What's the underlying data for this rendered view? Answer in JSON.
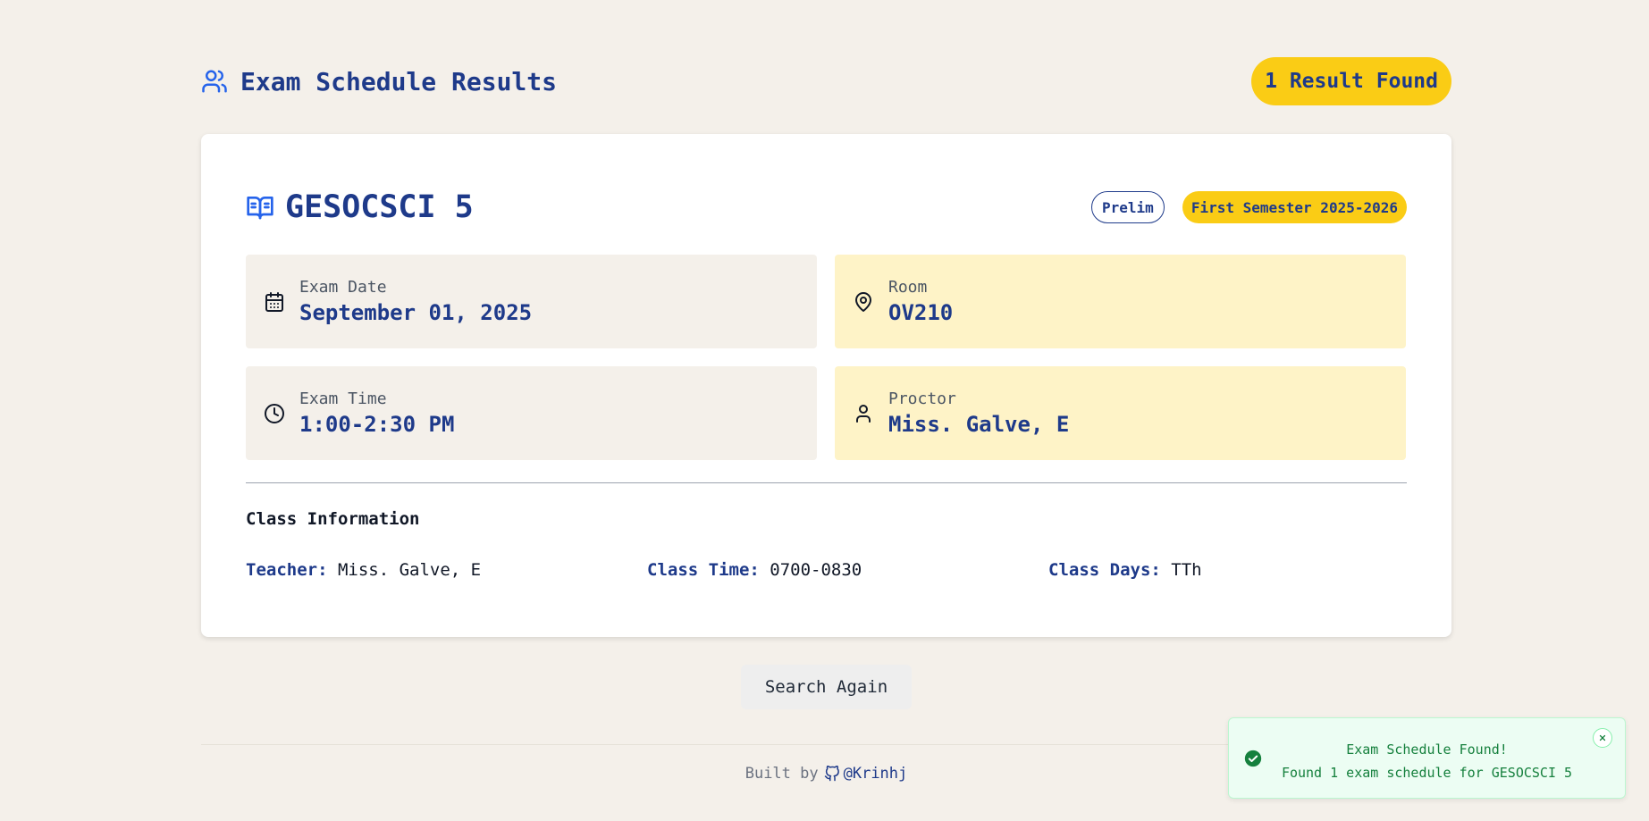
{
  "header": {
    "title": "Exam Schedule Results",
    "result_count": "1 Result Found",
    "icon": "users-icon"
  },
  "course": {
    "code": "GESOCSCI 5",
    "icon": "book-open-icon",
    "exam_type": "Prelim",
    "semester": "First Semester 2025-2026"
  },
  "details": {
    "exam_date": {
      "label": "Exam Date",
      "value": "September 01, 2025",
      "icon": "calendar-icon"
    },
    "room": {
      "label": "Room",
      "value": "OV210",
      "icon": "map-pin-icon"
    },
    "exam_time": {
      "label": "Exam Time",
      "value": "1:00-2:30 PM",
      "icon": "clock-icon"
    },
    "proctor": {
      "label": "Proctor",
      "value": "Miss. Galve, E",
      "icon": "user-icon"
    }
  },
  "class_info": {
    "title": "Class Information",
    "teacher_label": "Teacher:",
    "teacher": "Miss. Galve, E",
    "class_time_label": "Class Time:",
    "class_time": "0700-0830",
    "class_days_label": "Class Days:",
    "class_days": "TTh"
  },
  "actions": {
    "search_again": "Search Again"
  },
  "footer": {
    "built_by": "Built by",
    "handle": "@Krinhj",
    "icon": "github-icon"
  },
  "toast": {
    "title": "Exam Schedule Found!",
    "message": "Found 1 exam schedule for GESOCSCI 5",
    "icon": "check-circle-icon"
  },
  "colors": {
    "background": "#f4f0ea",
    "primary": "#1e3a8a",
    "accent": "#facc15",
    "accent_soft": "#fef3c7",
    "success": "#15803d"
  }
}
